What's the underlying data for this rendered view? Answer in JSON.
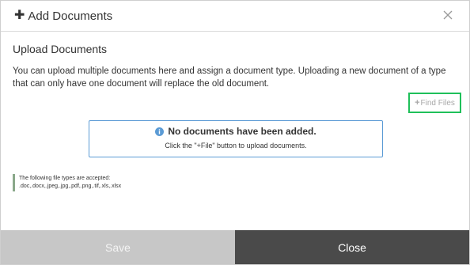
{
  "dialog": {
    "title": "Add Documents",
    "header_icon": "plus-icon",
    "close_icon": "close-icon"
  },
  "upload": {
    "section_title": "Upload Documents",
    "description": "You can upload multiple documents here and assign a document type. Uploading a new document of a type that can only have one document will replace the old document.",
    "find_files_label": "Find Files",
    "find_files_icon": "plus-icon"
  },
  "empty_state": {
    "icon": "info-icon",
    "heading": "No documents have been added.",
    "subtext": "Click the \"+File\" button to upload documents."
  },
  "file_types": {
    "line1": "The following file types are accepted:",
    "line2": ".doc,.docx,.jpeg,.jpg,.pdf,.png,.tif,.xls,.xlsx"
  },
  "footer": {
    "save_label": "Save",
    "close_label": "Close"
  },
  "colors": {
    "highlight_border": "#1fc05a",
    "empty_box_border": "#5b9bd5",
    "save_bg": "#c7c7c7",
    "close_bg": "#4a4a4a"
  }
}
